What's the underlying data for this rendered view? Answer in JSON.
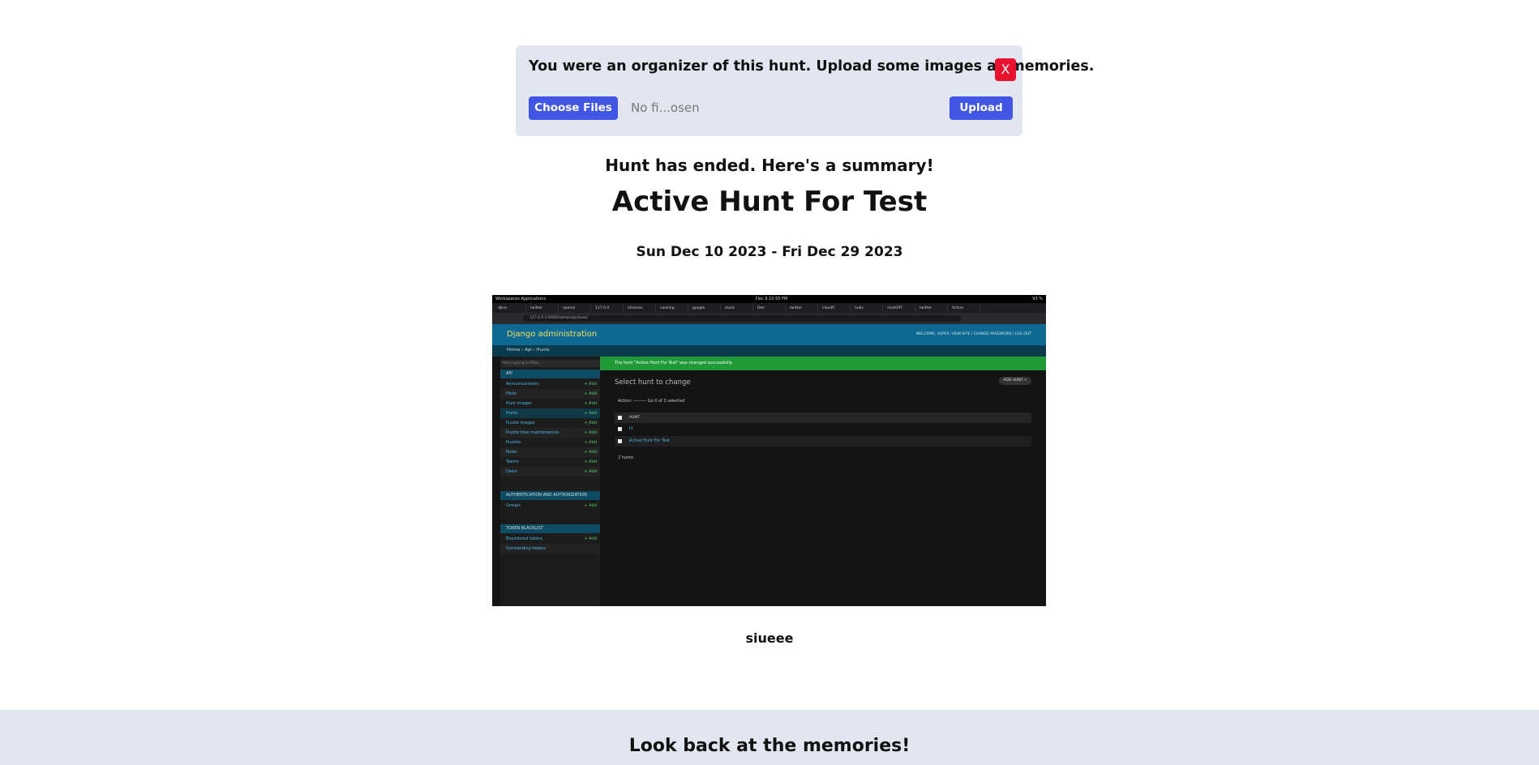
{
  "upload_banner": {
    "message": "You were an organizer of this hunt. Upload some images as memories.",
    "close_label": "X",
    "choose_label": "Choose Files",
    "file_name": "No fi...osen",
    "upload_label": "Upload"
  },
  "summary": {
    "ended_text": "Hunt has ended. Here's a summary!",
    "hunt_title": "Active Hunt For Test",
    "dates": "Sun Dec 10 2023 - Fri Dec 29 2023"
  },
  "memory_image": {
    "os_left": "Workspaces   Applications",
    "os_center": "Dec 9  10:55 PM",
    "os_right": "93 %",
    "tabs": [
      "djkm",
      "twitter",
      "openai",
      "127.0.0",
      "stresses",
      "cooking",
      "google",
      "stack",
      "Dell",
      "twitter",
      "cloudfl",
      "hubs",
      "chatGPT",
      "twitter",
      "Active"
    ],
    "url": "127.0.0.1:8000/admin/api/hunt/",
    "admin_title": "Django administration",
    "admin_user": "WELCOME, SUPER. VIEW SITE / CHANGE PASSWORD / LOG OUT",
    "breadcrumbs": "Home › Api › Hunts",
    "filter_placeholder": "Start typing to filter...",
    "api_header": "API",
    "api_items": [
      "Announcements",
      "Hints",
      "Hunt images",
      "Hunts",
      "Puzzle images",
      "Puzzle time maintenances",
      "Puzzles",
      "Roles",
      "Teams",
      "Users"
    ],
    "add_label": "+ Add",
    "auth_header": "AUTHENTICATION AND AUTHORIZATION",
    "auth_items": [
      "Groups"
    ],
    "token_header": "TOKEN BLACKLIST",
    "token_items": [
      "Blacklisted tokens",
      "Outstanding tokens"
    ],
    "success_msg": "The hunt \"Active Hunt For Test\" was changed successfully.",
    "select_title": "Select hunt to change",
    "add_hunt_label": "ADD HUNT +",
    "actions_text": "Action:  ---------   Go   0 of 2 selected",
    "table_header": "HUNT",
    "rows": [
      "t1",
      "Active Hunt For Test"
    ],
    "count_text": "2 hunts"
  },
  "caption": "siueee",
  "memories_heading": "Look back at the memories!"
}
